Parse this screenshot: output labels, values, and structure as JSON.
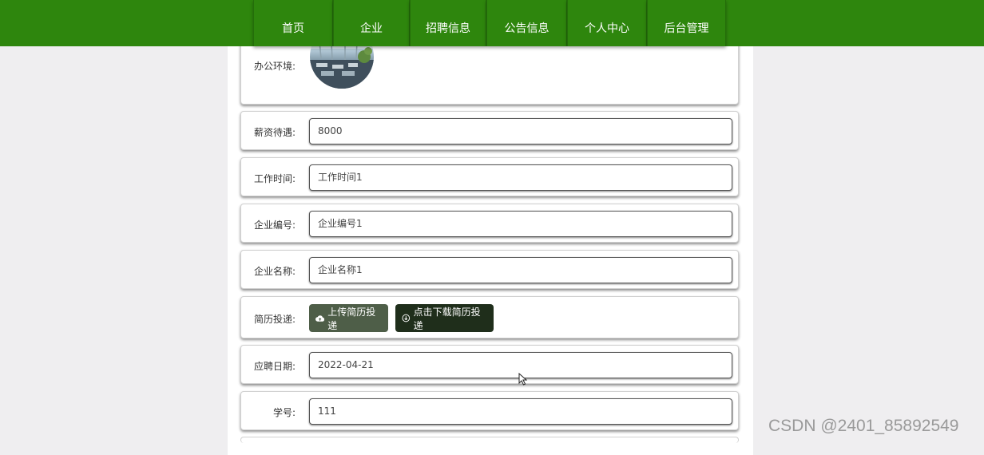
{
  "nav": {
    "items": [
      {
        "label": "首页"
      },
      {
        "label": "企业"
      },
      {
        "label": "招聘信息"
      },
      {
        "label": "公告信息"
      },
      {
        "label": "个人中心"
      },
      {
        "label": "后台管理"
      }
    ]
  },
  "form": {
    "office_label": "办公环境:",
    "salary": {
      "label": "薪资待遇:",
      "value": "8000"
    },
    "work_time": {
      "label": "工作时间:",
      "value": "工作时间1"
    },
    "company_id": {
      "label": "企业编号:",
      "value": "企业编号1"
    },
    "company_name": {
      "label": "企业名称:",
      "value": "企业名称1"
    },
    "resume": {
      "label": "简历投递:",
      "upload_label": "上传简历投递",
      "download_label": "点击下载简历投递",
      "upload_icon": "cloud-upload-icon",
      "download_icon": "download-circle-icon"
    },
    "apply_date": {
      "label": "应聘日期:",
      "value": "2022-04-21"
    },
    "student_id": {
      "label": "学号:",
      "value": "111"
    }
  },
  "watermark": "CSDN @2401_85892549",
  "colors": {
    "header": "#2e860d",
    "upload_button": "#4e5e48",
    "download_button": "#1f2e1b"
  }
}
